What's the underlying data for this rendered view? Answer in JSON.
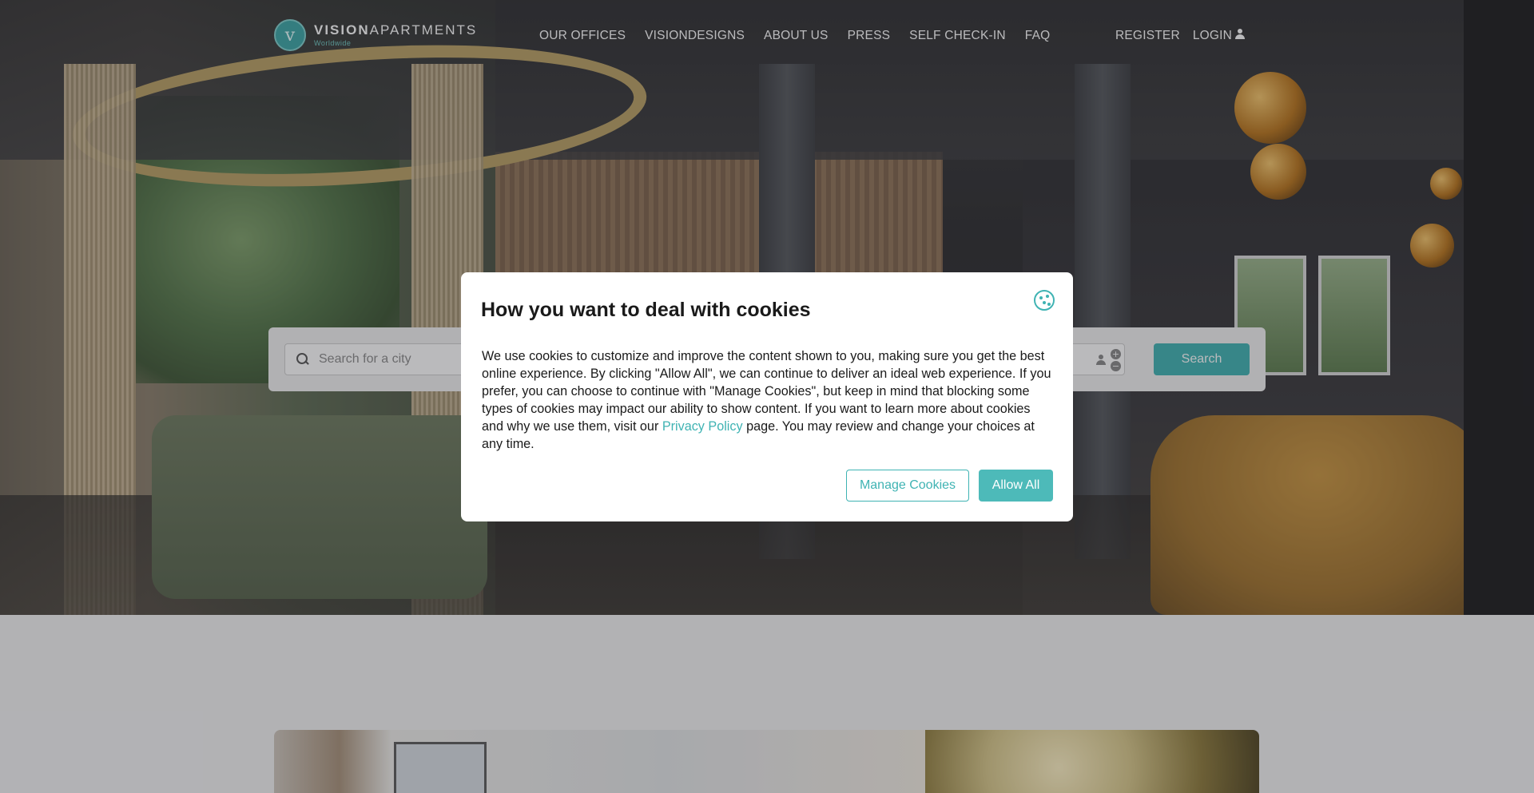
{
  "header": {
    "logo_name_bold": "VISION",
    "logo_name_light": "APARTMENTS",
    "logo_sub": "Worldwide",
    "nav": [
      "OUR OFFICES",
      "VISIONDESIGNS",
      "ABOUT US",
      "PRESS",
      "SELF CHECK-IN",
      "FAQ"
    ],
    "register": "REGISTER",
    "login": "LOGIN"
  },
  "search": {
    "placeholder": "Search for a city",
    "button_label": "Search",
    "stepper_plus": "+",
    "stepper_minus": "−"
  },
  "cookie_modal": {
    "title": "How you want to deal with cookies",
    "body_before_link": "We use cookies to customize and improve the content shown to you, making sure you get the best online experience. By clicking \"Allow All\", we can continue to deliver an ideal web experience. If you prefer, you can choose to continue with \"Manage Cookies\", but keep in mind that blocking some types of cookies may impact our ability to show content. If you want to learn more about cookies and why we use them, visit our ",
    "link_text": "Privacy Policy",
    "body_after_link": " page. You may review and change your choices at any time.",
    "manage_label": "Manage Cookies",
    "allow_label": "Allow All"
  },
  "colors": {
    "accent": "#3fb3b3",
    "overlay": "rgba(40,40,48,0.32)"
  }
}
